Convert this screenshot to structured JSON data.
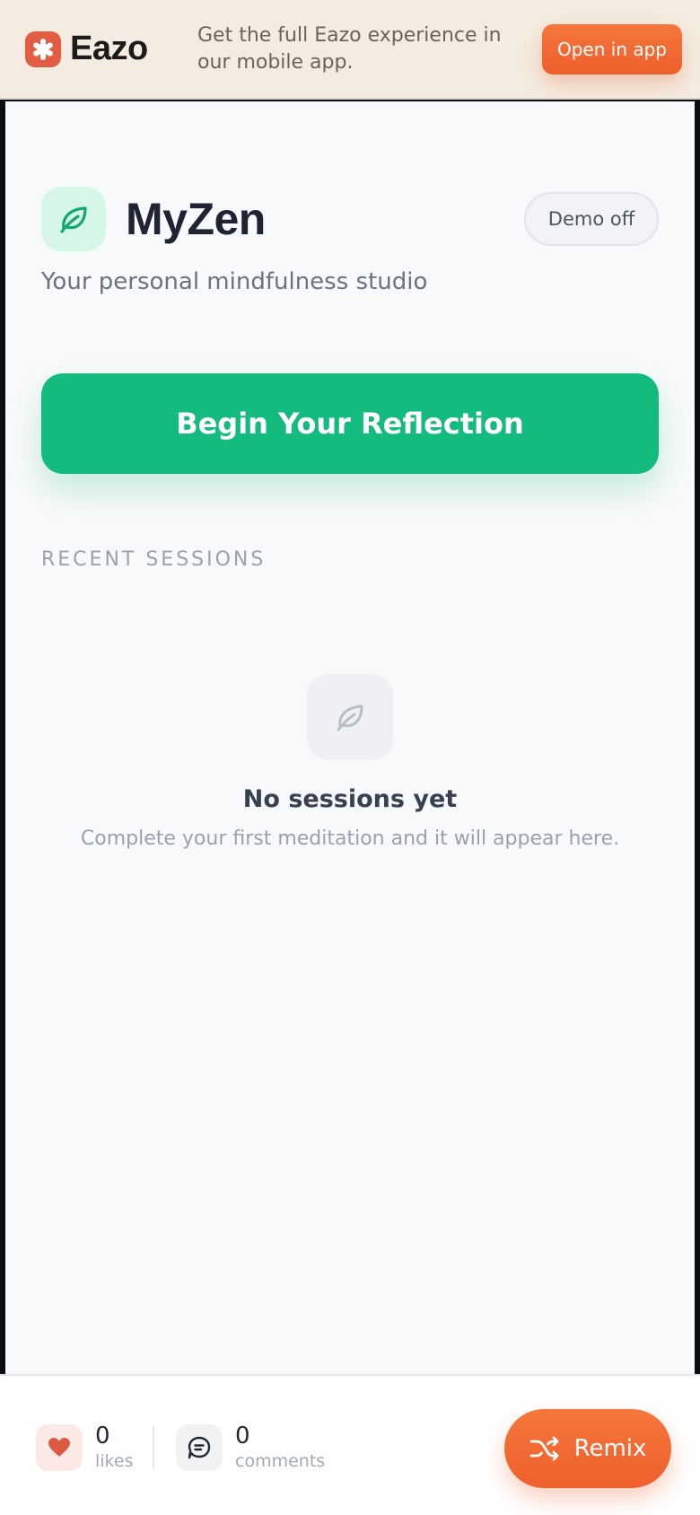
{
  "banner": {
    "brand_name": "Eazo",
    "message": "Get the full Eazo experience in our mobile app.",
    "open_app_label": "Open in app"
  },
  "app": {
    "title": "MyZen",
    "subtitle": "Your personal mindfulness studio",
    "demo_toggle_label": "Demo off",
    "primary_cta_label": "Begin Your Reflection",
    "section_label": "RECENT SESSIONS",
    "empty_state": {
      "title": "No sessions yet",
      "description": "Complete your first meditation and it will appear here."
    }
  },
  "footer": {
    "likes": {
      "count": "0",
      "label": "likes"
    },
    "comments": {
      "count": "0",
      "label": "comments"
    },
    "remix_label": "Remix"
  },
  "icons": {
    "brand": "asterisk-logo-icon",
    "app_logo": "leaf-icon",
    "empty": "leaf-icon",
    "likes": "heart-icon",
    "comments": "chat-bubble-icon",
    "remix": "shuffle-icon"
  },
  "colors": {
    "accent_green": "#13bb7f",
    "accent_orange": "#ee5f2b",
    "brand_red": "#e25d43",
    "banner_bg": "#f4ece0",
    "app_bg": "#f8f9fb"
  }
}
